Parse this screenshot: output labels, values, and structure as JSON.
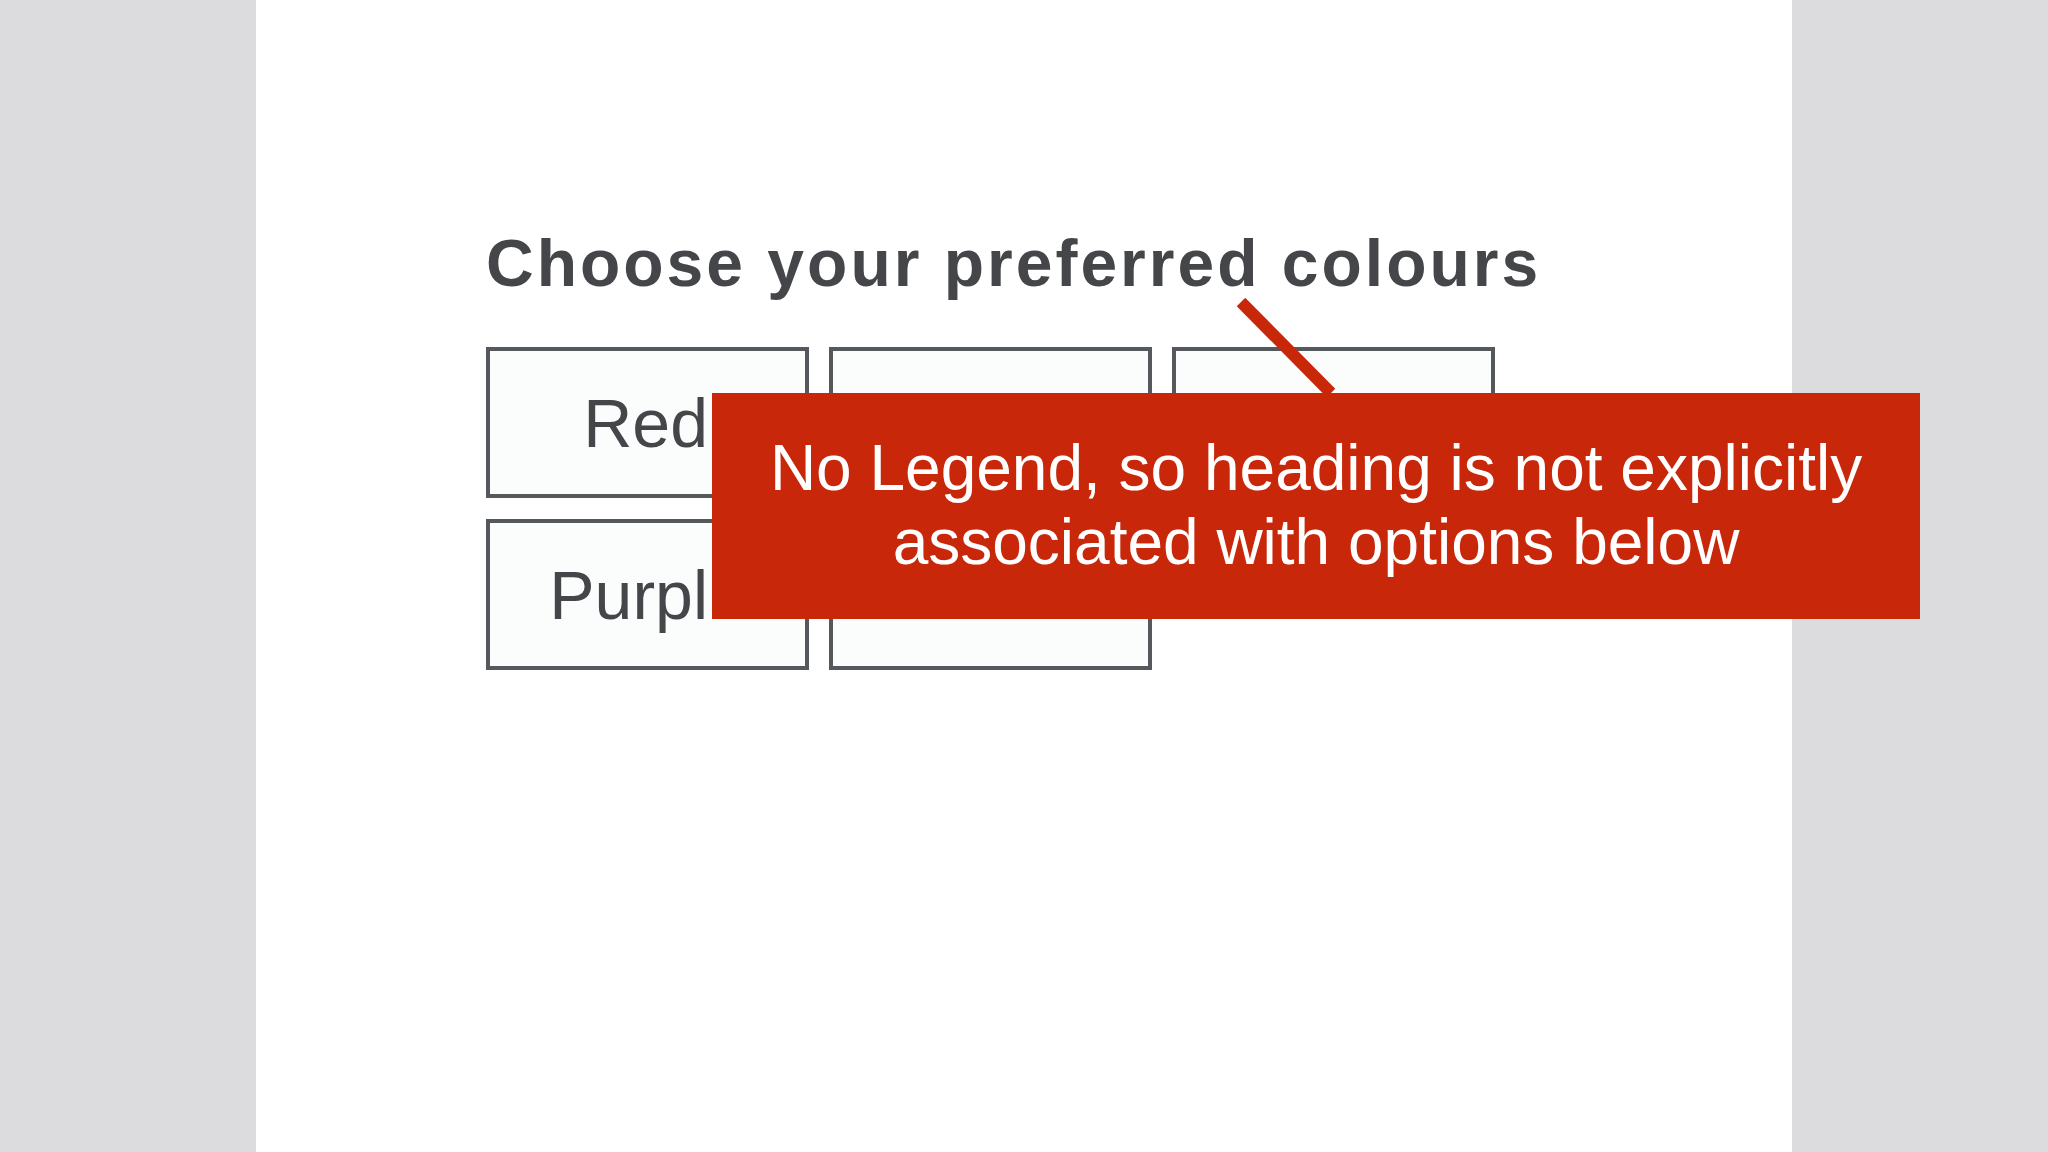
{
  "page": {
    "heading": "Choose your preferred colours",
    "option_rows": [
      {
        "options": [
          {
            "kind": "labeled",
            "label": "Red"
          },
          {
            "kind": "covered"
          },
          {
            "kind": "covered"
          }
        ]
      },
      {
        "options": [
          {
            "kind": "labeled",
            "label": "Purpl"
          },
          {
            "kind": "covered"
          }
        ]
      }
    ]
  },
  "callout": {
    "text": "No Legend, so heading is not explicitly associated with options below"
  }
}
